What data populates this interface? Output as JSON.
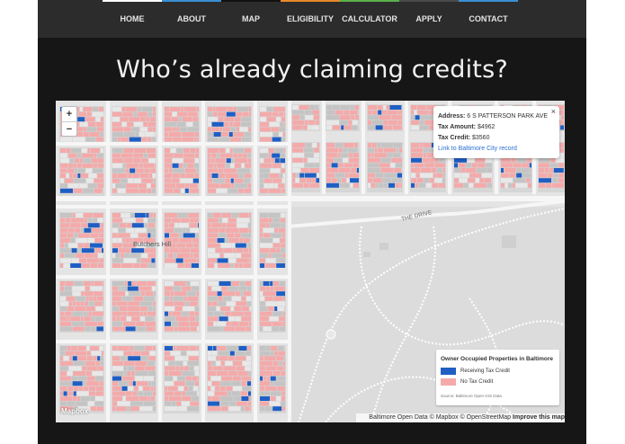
{
  "nav": {
    "items": [
      {
        "label": "HOME",
        "color": "#ffffff"
      },
      {
        "label": "ABOUT",
        "color": "#3a8fd4"
      },
      {
        "label": "MAP",
        "color": "#111111"
      },
      {
        "label": "ELIGIBILITY",
        "color": "#e8892a"
      },
      {
        "label": "CALCULATOR",
        "color": "#5ab04a"
      },
      {
        "label": "APPLY",
        "color": "#4a4a4a"
      },
      {
        "label": "CONTACT",
        "color": "#3a8fd4"
      }
    ]
  },
  "headline": "Who’s already claiming credits?",
  "map": {
    "zoom_in": "+",
    "zoom_out": "−",
    "popup": {
      "address_label": "Address:",
      "address_value": "6 S PATTERSON PARK AVE",
      "tax_amount_label": "Tax Amount:",
      "tax_amount_value": "$4962",
      "tax_credit_label": "Tax Credit:",
      "tax_credit_value": "$3560",
      "link": "Link to Baltimore City record",
      "close": "×"
    },
    "street_labels": {
      "drive": "THE DRIVE",
      "neighborhood": "Butchers Hill"
    },
    "legend": {
      "title": "Owner Occupied Properties in Baltimore",
      "receiving": "Receiving Tax Credit",
      "no_credit": "No Tax Credit",
      "source": "Source: Baltimore Open GIS Data",
      "receiving_color": "#1f5fc4",
      "no_credit_color": "#f4aaaa"
    },
    "attribution": "Baltimore Open Data © Mapbox © OpenStreetMap",
    "improve": "Improve this map",
    "logo": "Mapbox"
  },
  "colors": {
    "page_bg": "#161616",
    "nav_bg": "#2c2c2c",
    "park": "#dcdcdc",
    "road": "#f6f6f6",
    "building_gray": "#c4c4c4"
  }
}
